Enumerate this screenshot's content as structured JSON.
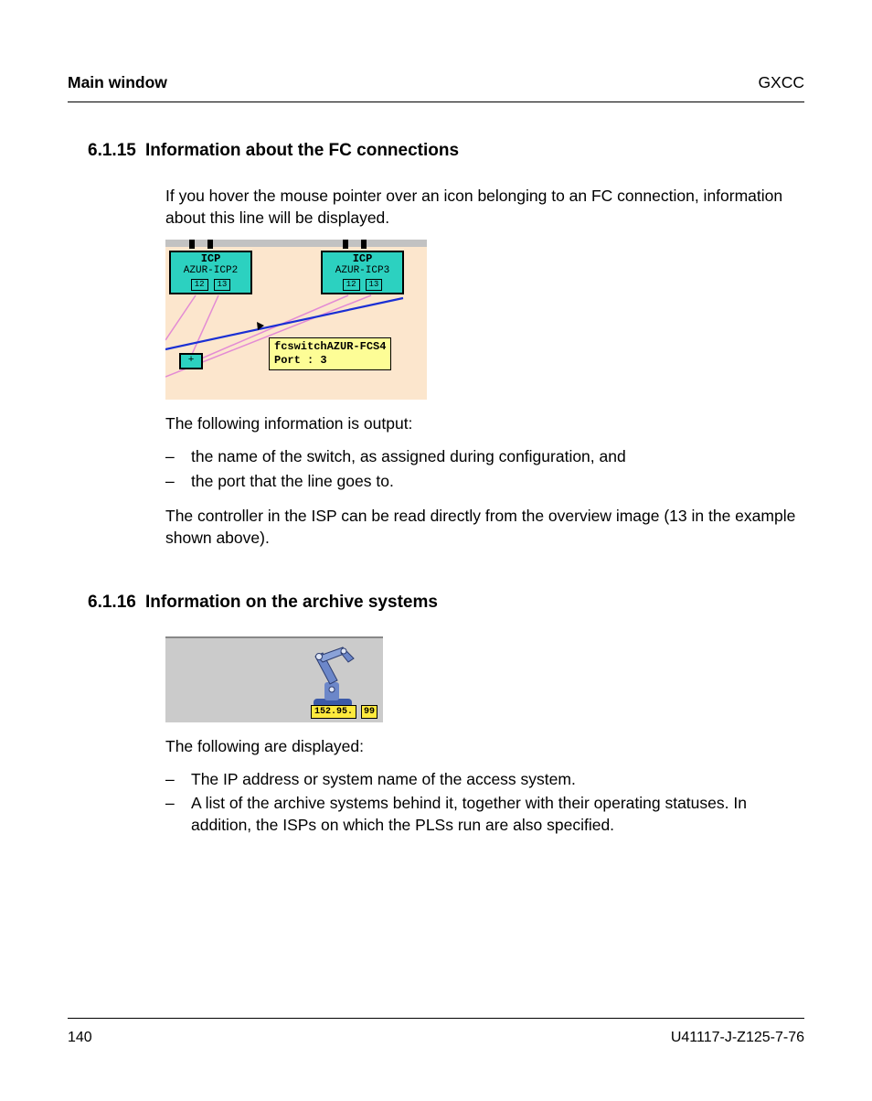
{
  "header": {
    "left": "Main window",
    "right": "GXCC"
  },
  "sec1": {
    "number": "6.1.15",
    "title": "Information about the FC connections",
    "intro": "If you hover the mouse pointer over an icon belonging to an FC connection, information about this line will be displayed.",
    "after_fig": "The following information is output:",
    "bullets": [
      "the name of the switch, as assigned during configuration, and",
      "the port that the line goes to."
    ],
    "closing": "The controller in the ISP can be read directly from the overview image (13 in the example shown above)."
  },
  "fig1": {
    "icp_label": "ICP",
    "icp2": "AZUR-ICP2",
    "icp3": "AZUR-ICP3",
    "port12": "12",
    "port13": "13",
    "tooltip_l1": "fcswitchAZUR-FCS4",
    "tooltip_l2": "Port : 3",
    "plus": "+"
  },
  "sec2": {
    "number": "6.1.16",
    "title": "Information on the archive systems",
    "after_fig": "The following are displayed:",
    "bullets": [
      "The IP address or system name of the access system.",
      "A list of the archive systems behind it, together with their operating statuses. In addition, the ISPs on which the PLSs run are also specified."
    ]
  },
  "fig2": {
    "ip_fragment": "152.95.",
    "num": "99"
  },
  "footer": {
    "page": "140",
    "docid": "U41117-J-Z125-7-76"
  }
}
